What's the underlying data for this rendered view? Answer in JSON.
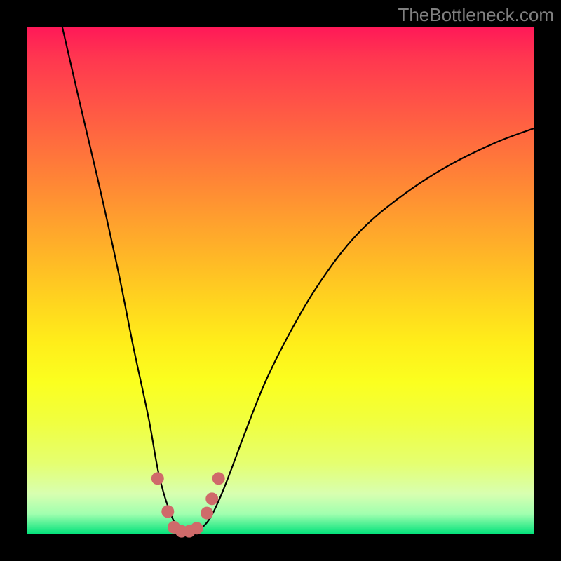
{
  "watermark": "TheBottleneck.com",
  "colors": {
    "frame": "#000000",
    "gradient_top": "#ff1858",
    "gradient_bottom": "#00e27a",
    "curve": "#000000",
    "marker_fill": "#cf6a6a",
    "marker_stroke": "#cf6a6a"
  },
  "chart_data": {
    "type": "line",
    "title": "",
    "xlabel": "",
    "ylabel": "",
    "xlim": [
      0,
      100
    ],
    "ylim": [
      0,
      100
    ],
    "grid": false,
    "note": "x is normalized horizontal position (0=left, 100=right inside plot area); y is normalized vertical value (0=bottom, 100=top). Background hue maps low y→green, high y→red. Curve depicts a bottleneck-style V: steep descent on the left, flat minimum near x≈30, gentler rise on the right.",
    "series": [
      {
        "name": "curve",
        "x": [
          7,
          10,
          14,
          18,
          21,
          24,
          26,
          28,
          30,
          32,
          34,
          36,
          38,
          40,
          43,
          47,
          52,
          58,
          65,
          73,
          82,
          92,
          100
        ],
        "y": [
          100,
          87,
          70,
          52,
          37,
          23,
          12,
          5,
          1,
          0.5,
          1,
          3,
          7,
          12,
          20,
          30,
          40,
          50,
          59,
          66,
          72,
          77,
          80
        ]
      }
    ],
    "markers": {
      "name": "highlight-points",
      "shape": "circle",
      "x": [
        25.8,
        27.8,
        29,
        30.5,
        32,
        33.5,
        35.5,
        36.5,
        37.8
      ],
      "y": [
        11,
        4.5,
        1.4,
        0.6,
        0.6,
        1.2,
        4.2,
        7,
        11
      ]
    }
  }
}
